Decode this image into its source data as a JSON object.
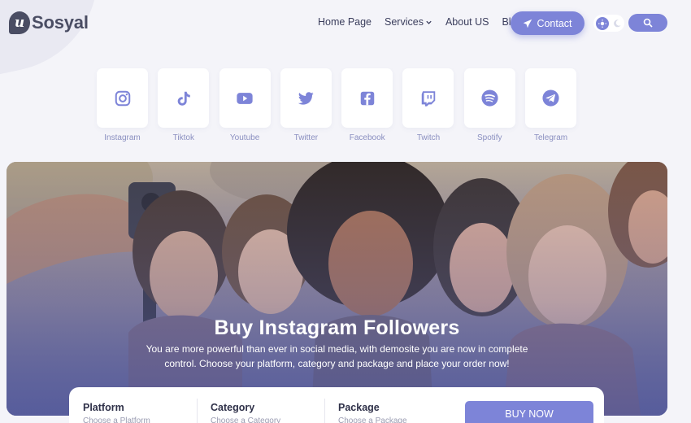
{
  "brand": {
    "name": "Sosyal",
    "logo_letter": "u"
  },
  "nav": {
    "items": [
      {
        "label": "Home Page",
        "has_dropdown": false
      },
      {
        "label": "Services",
        "has_dropdown": true
      },
      {
        "label": "About US",
        "has_dropdown": false
      },
      {
        "label": "Blog",
        "has_dropdown": false
      }
    ],
    "contact_label": "Contact"
  },
  "platforms": [
    {
      "label": "Instagram",
      "icon": "instagram-icon"
    },
    {
      "label": "Tiktok",
      "icon": "tiktok-icon"
    },
    {
      "label": "Youtube",
      "icon": "youtube-icon"
    },
    {
      "label": "Twitter",
      "icon": "twitter-icon"
    },
    {
      "label": "Facebook",
      "icon": "facebook-icon"
    },
    {
      "label": "Twitch",
      "icon": "twitch-icon"
    },
    {
      "label": "Spotify",
      "icon": "spotify-icon"
    },
    {
      "label": "Telegram",
      "icon": "telegram-icon"
    }
  ],
  "hero": {
    "title": "Buy Instagram Followers",
    "subtitle": "You are more powerful than ever in social media, with demosite you are now in complete control. Choose your platform, category and package and place your order now!"
  },
  "order_form": {
    "fields": [
      {
        "label": "Platform",
        "placeholder": "Choose a Platform"
      },
      {
        "label": "Category",
        "placeholder": "Choose a Category"
      },
      {
        "label": "Package",
        "placeholder": "Choose a Package"
      }
    ],
    "submit_label": "BUY NOW"
  },
  "colors": {
    "accent": "#7d84d8",
    "page_bg": "#f4f4f9",
    "text_dark": "#3a3d5c",
    "label_muted": "#8a8fc0"
  }
}
